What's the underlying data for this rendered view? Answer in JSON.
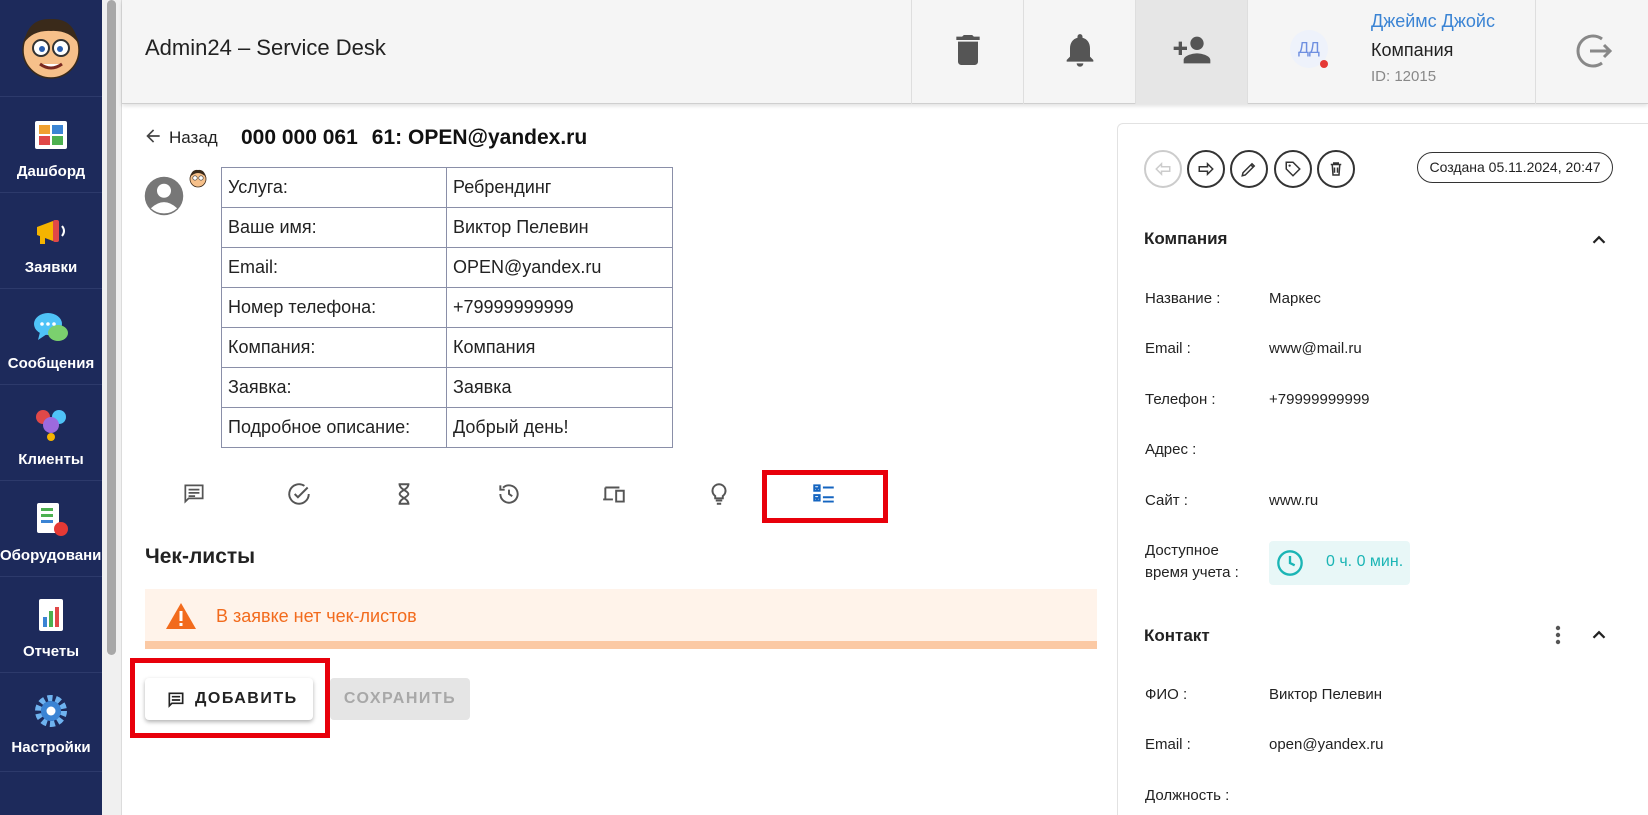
{
  "app": {
    "title": "Admin24 – Service Desk"
  },
  "sidebar": {
    "items": [
      {
        "label": "Дашборд",
        "icon": "dashboard-icon"
      },
      {
        "label": "Заявки",
        "icon": "megaphone-icon"
      },
      {
        "label": "Сообщения",
        "icon": "chat-bubble-icon"
      },
      {
        "label": "Клиенты",
        "icon": "clients-icon"
      },
      {
        "label": "Оборудование",
        "icon": "equipment-icon"
      },
      {
        "label": "Отчеты",
        "icon": "report-icon"
      },
      {
        "label": "Настройки",
        "icon": "gear-icon"
      }
    ]
  },
  "header": {
    "user": {
      "initials": "ДД",
      "name": "Джеймс Джойс",
      "company": "Компания",
      "id": "ID: 12015"
    }
  },
  "ticket": {
    "back_label": "Назад",
    "number": "000 000 061",
    "subject": "61: OPEN@yandex.ru",
    "fields": [
      {
        "key": "Услуга:",
        "value": "Ребрендинг"
      },
      {
        "key": "Ваше имя:",
        "value": "Виктор Пелевин"
      },
      {
        "key": "Email:",
        "value": "OPEN@yandex.ru"
      },
      {
        "key": "Номер телефона:",
        "value": "+79999999999"
      },
      {
        "key": "Компания:",
        "value": "Компания"
      },
      {
        "key": "Заявка:",
        "value": "Заявка"
      },
      {
        "key": "Подробное описание:",
        "value": "Добрый день!"
      }
    ]
  },
  "checklists": {
    "title": "Чек-листы",
    "empty_message": "В заявке нет чек-листов",
    "add_label": "ДОБАВИТЬ",
    "save_label": "СОХРАНИТЬ"
  },
  "panel": {
    "created": "Создана 05.11.2024, 20:47",
    "company": {
      "title": "Компания",
      "fields": [
        {
          "key": "Название :",
          "value": "Маркес"
        },
        {
          "key": "Email :",
          "value": "www@mail.ru"
        },
        {
          "key": "Телефон :",
          "value": "+79999999999"
        },
        {
          "key": "Адрес :",
          "value": ""
        },
        {
          "key": "Сайт :",
          "value": "www.ru"
        }
      ],
      "time_key_line1": "Доступное",
      "time_key_line2": "время учета :",
      "time_value": "0 ч. 0 мин."
    },
    "contact": {
      "title": "Контакт",
      "fields": [
        {
          "key": "ФИО :",
          "value": "Виктор Пелевин"
        },
        {
          "key": "Email :",
          "value": "open@yandex.ru"
        },
        {
          "key": "Должность :",
          "value": ""
        }
      ]
    }
  },
  "colors": {
    "sidebar_bg": "#1d2a5b",
    "highlight": "#e8000b",
    "alert_text": "#f26b1d",
    "link": "#3b84d4",
    "teal": "#1bb5b5"
  }
}
